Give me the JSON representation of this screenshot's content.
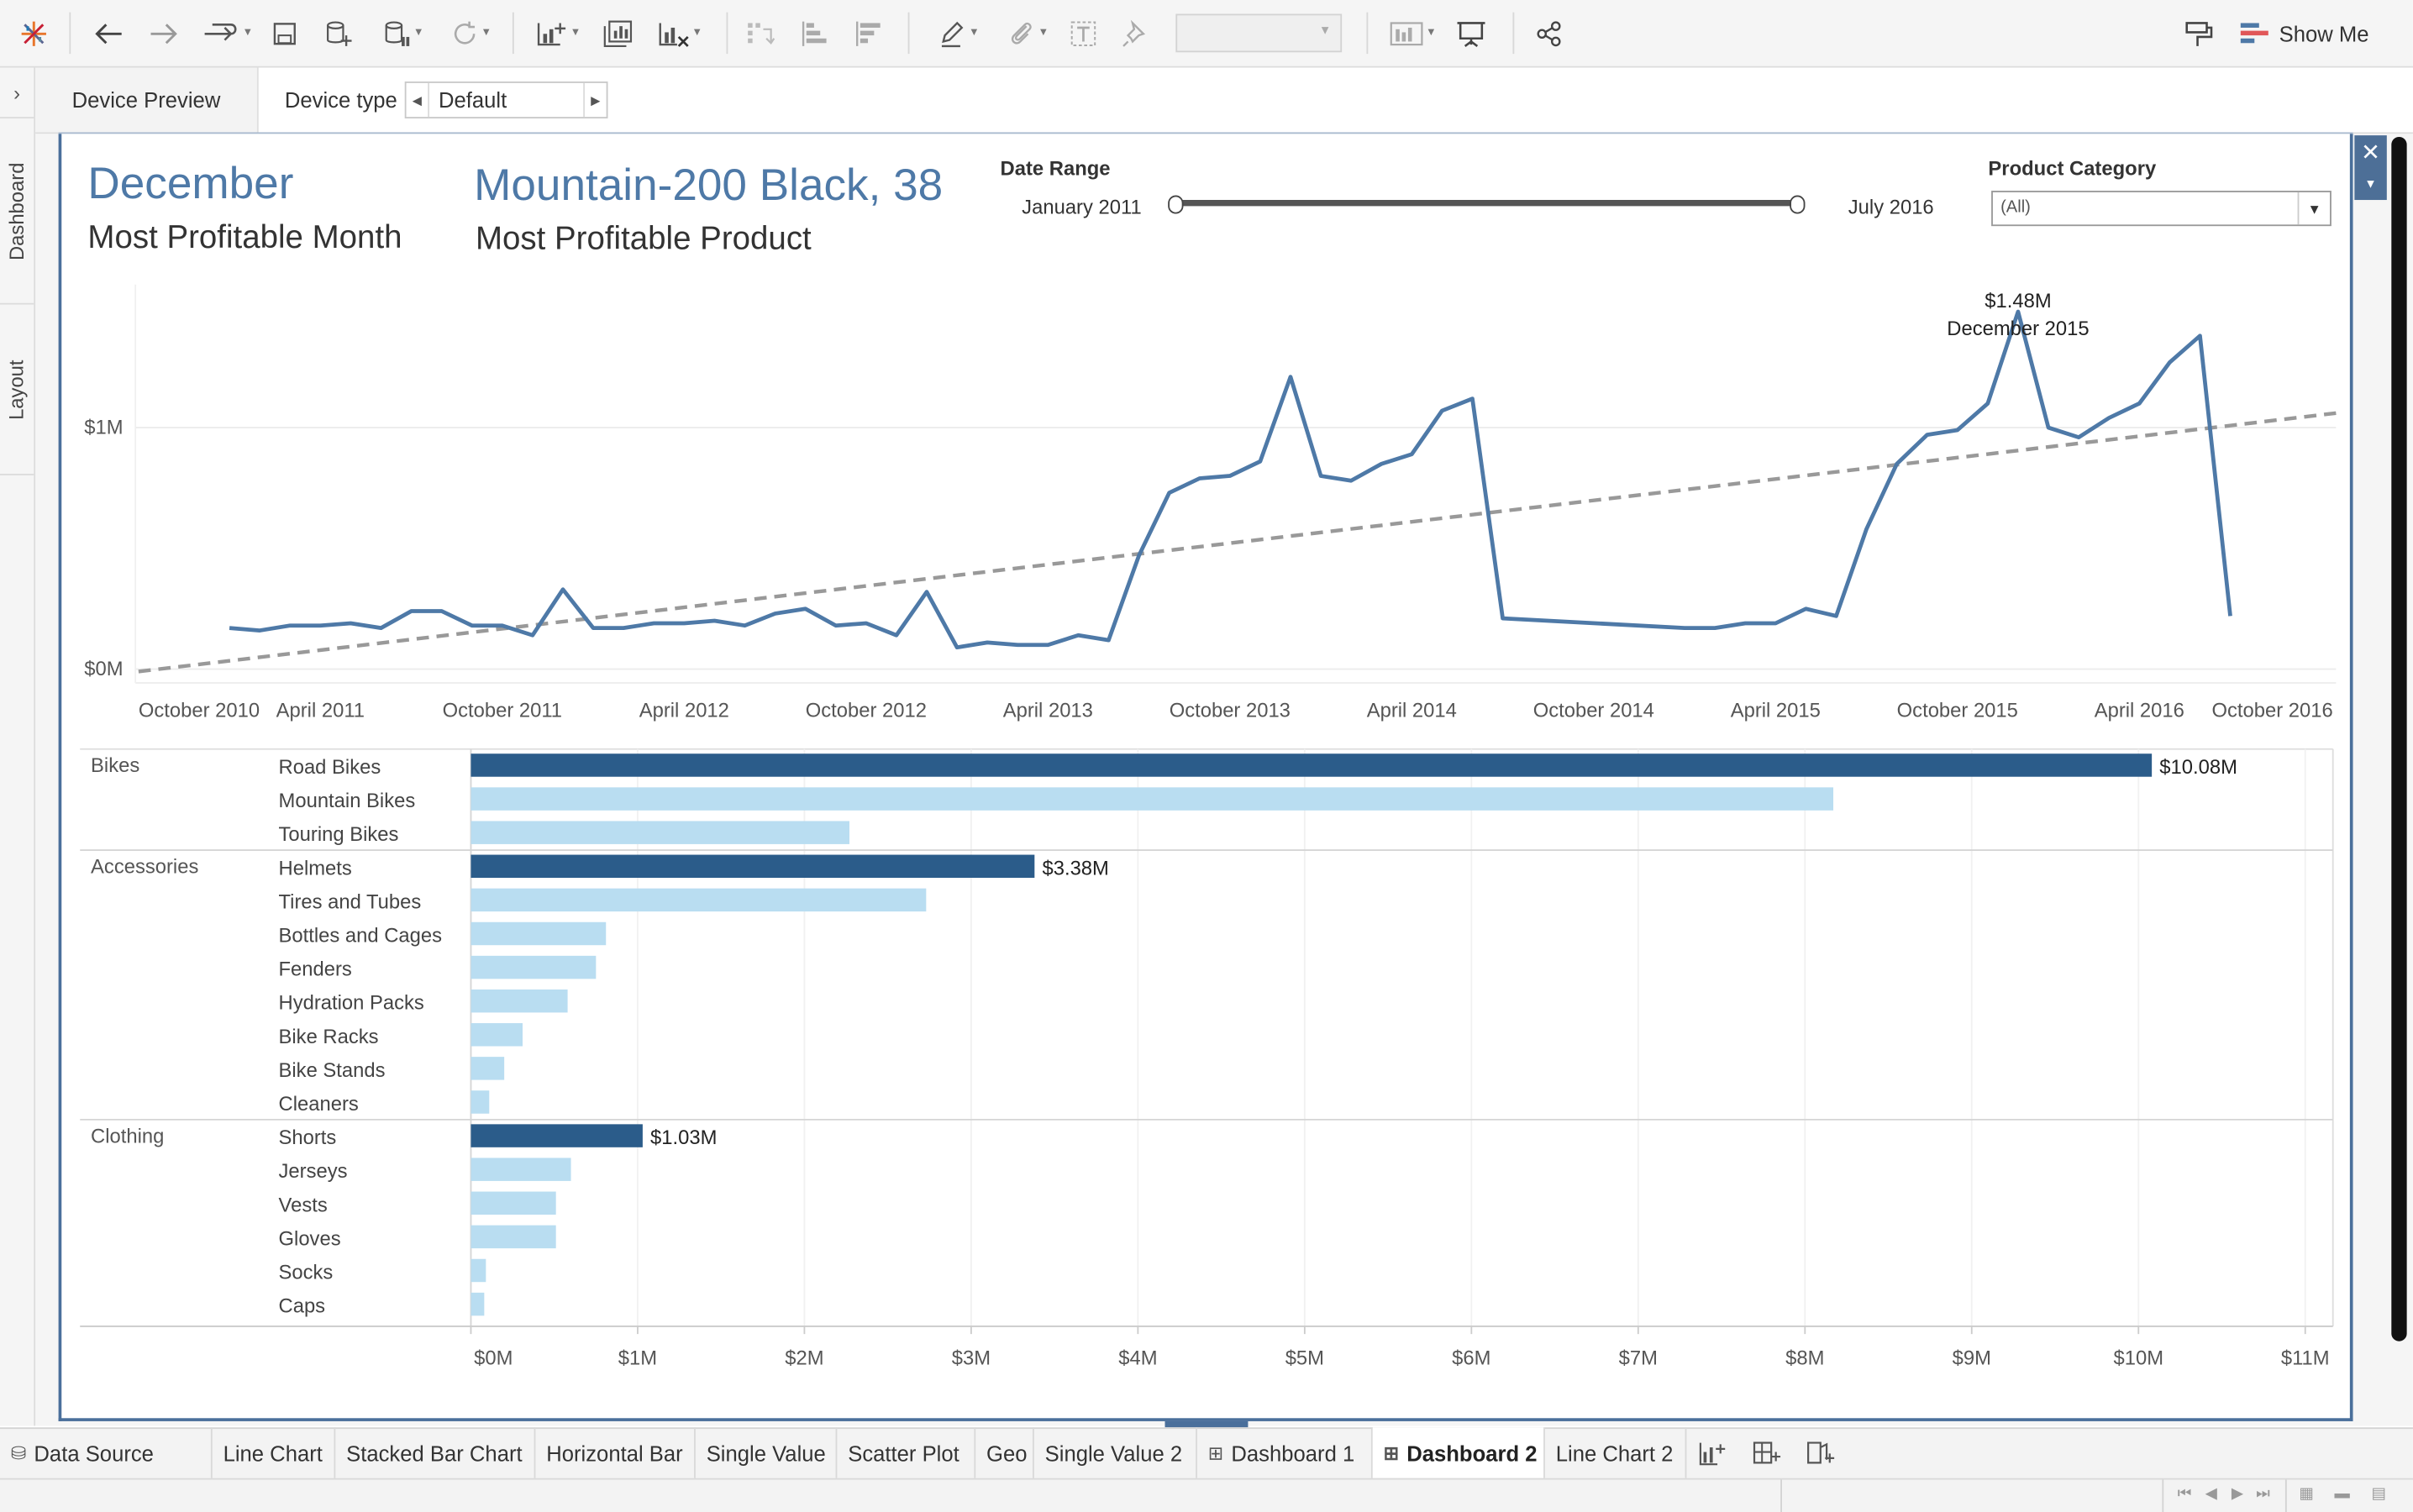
{
  "toolbar": {
    "show_me_label": "Show Me",
    "icons": [
      "tableau-logo-icon",
      "undo-icon",
      "redo-icon",
      "replay-icon",
      "save-icon",
      "new-data-source-icon",
      "data-source-pause-icon",
      "refresh-icon",
      "new-worksheet-icon",
      "duplicate-sheet-icon",
      "clear-sheet-icon",
      "swap-icon",
      "sort-ascending-icon",
      "sort-descending-icon",
      "highlight-icon",
      "group-icon",
      "labels-icon",
      "fix-axes-icon",
      "fit-dropdown",
      "show-cards-icon",
      "presentation-mode-icon",
      "share-icon",
      "pin-icon",
      "show-me-icon"
    ]
  },
  "side_tabs": {
    "dashboard": "Dashboard",
    "layout": "Layout"
  },
  "device_bar": {
    "preview_label": "Device Preview",
    "type_label": "Device type",
    "type_value": "Default"
  },
  "kpis": {
    "month_value": "December",
    "month_label": "Most Profitable Month",
    "product_value": "Mountain-200 Black, 38",
    "product_label": "Most Profitable Product"
  },
  "filters": {
    "date_range_title": "Date Range",
    "date_start": "January 2011",
    "date_end": "July 2016",
    "category_title": "Product Category",
    "category_value": "(All)"
  },
  "colors": {
    "accent": "#4e79a7",
    "bar_dark": "#2b5c8a",
    "bar_light": "#b9ddf1",
    "trend": "#999999"
  },
  "chart_data": [
    {
      "type": "line",
      "title": "",
      "x_ticks": [
        "October 2010",
        "April 2011",
        "October 2011",
        "April 2012",
        "October 2012",
        "April 2013",
        "October 2013",
        "April 2014",
        "October 2014",
        "April 2015",
        "October 2015",
        "April 2016",
        "October 2016"
      ],
      "y_ticks": [
        "$0M",
        "$1M"
      ],
      "ylim_millions": [
        0,
        1.5
      ],
      "series": [
        {
          "x": [
            "2011-01",
            "2011-02",
            "2011-03",
            "2011-04",
            "2011-05",
            "2011-06",
            "2011-07",
            "2011-08",
            "2011-09",
            "2011-10",
            "2011-11",
            "2011-12",
            "2012-01",
            "2012-02",
            "2012-03",
            "2012-04",
            "2012-05",
            "2012-06",
            "2012-07",
            "2012-08",
            "2012-09",
            "2012-10",
            "2012-11",
            "2012-12",
            "2013-01",
            "2013-02",
            "2013-03",
            "2013-04",
            "2013-05",
            "2013-06",
            "2013-07",
            "2013-08",
            "2013-09",
            "2013-10",
            "2013-11",
            "2013-12",
            "2014-01",
            "2014-02",
            "2014-03",
            "2014-04",
            "2014-05",
            "2014-06",
            "2014-07",
            "2015-01",
            "2015-02",
            "2015-03",
            "2015-04",
            "2015-05",
            "2015-06",
            "2015-07",
            "2015-08",
            "2015-09",
            "2015-10",
            "2015-11",
            "2015-12",
            "2016-01",
            "2016-02",
            "2016-03",
            "2016-04",
            "2016-05",
            "2016-06",
            "2016-07"
          ],
          "y": [
            0.17,
            0.16,
            0.18,
            0.18,
            0.19,
            0.17,
            0.24,
            0.24,
            0.18,
            0.18,
            0.14,
            0.33,
            0.17,
            0.17,
            0.19,
            0.19,
            0.2,
            0.18,
            0.23,
            0.25,
            0.18,
            0.19,
            0.14,
            0.32,
            0.09,
            0.11,
            0.1,
            0.1,
            0.14,
            0.12,
            0.47,
            0.73,
            0.79,
            0.8,
            0.86,
            1.21,
            0.8,
            0.78,
            0.85,
            0.89,
            1.07,
            1.12,
            0.21,
            0.17,
            0.17,
            0.19,
            0.19,
            0.25,
            0.22,
            0.58,
            0.85,
            0.97,
            0.99,
            1.1,
            1.48,
            1.0,
            0.96,
            1.04,
            1.1,
            1.27,
            1.38,
            0.22
          ]
        }
      ],
      "trend_line": {
        "start_millions": -0.01,
        "end_millions": 1.06
      },
      "annotation": {
        "value": "$1.48M",
        "label": "December 2015"
      }
    },
    {
      "type": "bar",
      "orientation": "horizontal",
      "x_ticks": [
        "$0M",
        "$1M",
        "$2M",
        "$3M",
        "$4M",
        "$5M",
        "$6M",
        "$7M",
        "$8M",
        "$9M",
        "$10M",
        "$11M"
      ],
      "xlim_millions": [
        0,
        11.1
      ],
      "groups": [
        {
          "name": "Bikes",
          "items": [
            {
              "name": "Road Bikes",
              "value": 10.08,
              "label": "$10.08M",
              "top": true
            },
            {
              "name": "Mountain Bikes",
              "value": 8.17
            },
            {
              "name": "Touring Bikes",
              "value": 2.27
            }
          ]
        },
        {
          "name": "Accessories",
          "items": [
            {
              "name": "Helmets",
              "value": 3.38,
              "label": "$3.38M",
              "top": true
            },
            {
              "name": "Tires and Tubes",
              "value": 2.73
            },
            {
              "name": "Bottles and Cages",
              "value": 0.81
            },
            {
              "name": "Fenders",
              "value": 0.75
            },
            {
              "name": "Hydration Packs",
              "value": 0.58
            },
            {
              "name": "Bike Racks",
              "value": 0.31
            },
            {
              "name": "Bike Stands",
              "value": 0.2
            },
            {
              "name": "Cleaners",
              "value": 0.11
            }
          ]
        },
        {
          "name": "Clothing",
          "items": [
            {
              "name": "Shorts",
              "value": 1.03,
              "label": "$1.03M",
              "top": true
            },
            {
              "name": "Jerseys",
              "value": 0.6
            },
            {
              "name": "Vests",
              "value": 0.51
            },
            {
              "name": "Gloves",
              "value": 0.51
            },
            {
              "name": "Socks",
              "value": 0.09
            },
            {
              "name": "Caps",
              "value": 0.08
            }
          ]
        }
      ]
    }
  ],
  "tabs": [
    {
      "label": "Data Source",
      "icon": "database-icon"
    },
    {
      "label": "Line Chart"
    },
    {
      "label": "Stacked Bar Chart"
    },
    {
      "label": "Horizontal Bar"
    },
    {
      "label": "Single Value"
    },
    {
      "label": "Scatter Plot"
    },
    {
      "label": "Geo"
    },
    {
      "label": "Single Value 2"
    },
    {
      "label": "Dashboard 1",
      "icon": "dashboard-icon"
    },
    {
      "label": "Dashboard 2",
      "icon": "dashboard-icon",
      "active": true
    },
    {
      "label": "Line Chart 2"
    }
  ]
}
